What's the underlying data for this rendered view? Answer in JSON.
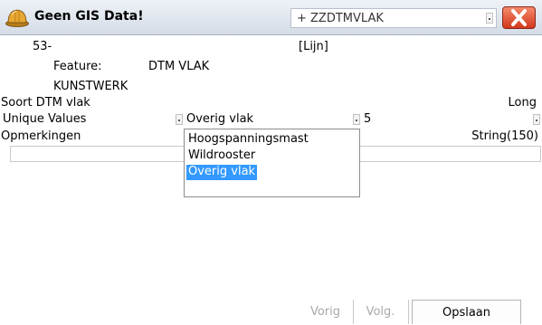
{
  "titlebar": {
    "title": "Geen GIS Data!",
    "mode_value": "+ ZZDTMVLAK",
    "helmet_icon": "hard-hat-icon",
    "close_icon": "close-x-icon",
    "close_color": "#d3371a"
  },
  "info": {
    "id": "53-",
    "geometry_type": "[Lijn]",
    "feature_label": "Feature:",
    "feature_value": "DTM VLAK",
    "category": "KUNSTWERK"
  },
  "attribute1": {
    "label": "Soort DTM vlak",
    "type": "Long",
    "mode_value": "Unique Values",
    "value": "Overig vlak",
    "extra_value": "5",
    "options": [
      "Hoogspanningsmast",
      "Wildrooster",
      "Overig vlak"
    ],
    "selected_index": 2
  },
  "attribute2": {
    "label": "Opmerkingen",
    "type": "String(150)",
    "value": ""
  },
  "footer": {
    "prev": "Vorig",
    "next": "Volg.",
    "save": "Opslaan"
  },
  "colors": {
    "selection": "#3399ff",
    "titlebar": "#d4dce6",
    "disabled_text": "#a9a9a9"
  }
}
